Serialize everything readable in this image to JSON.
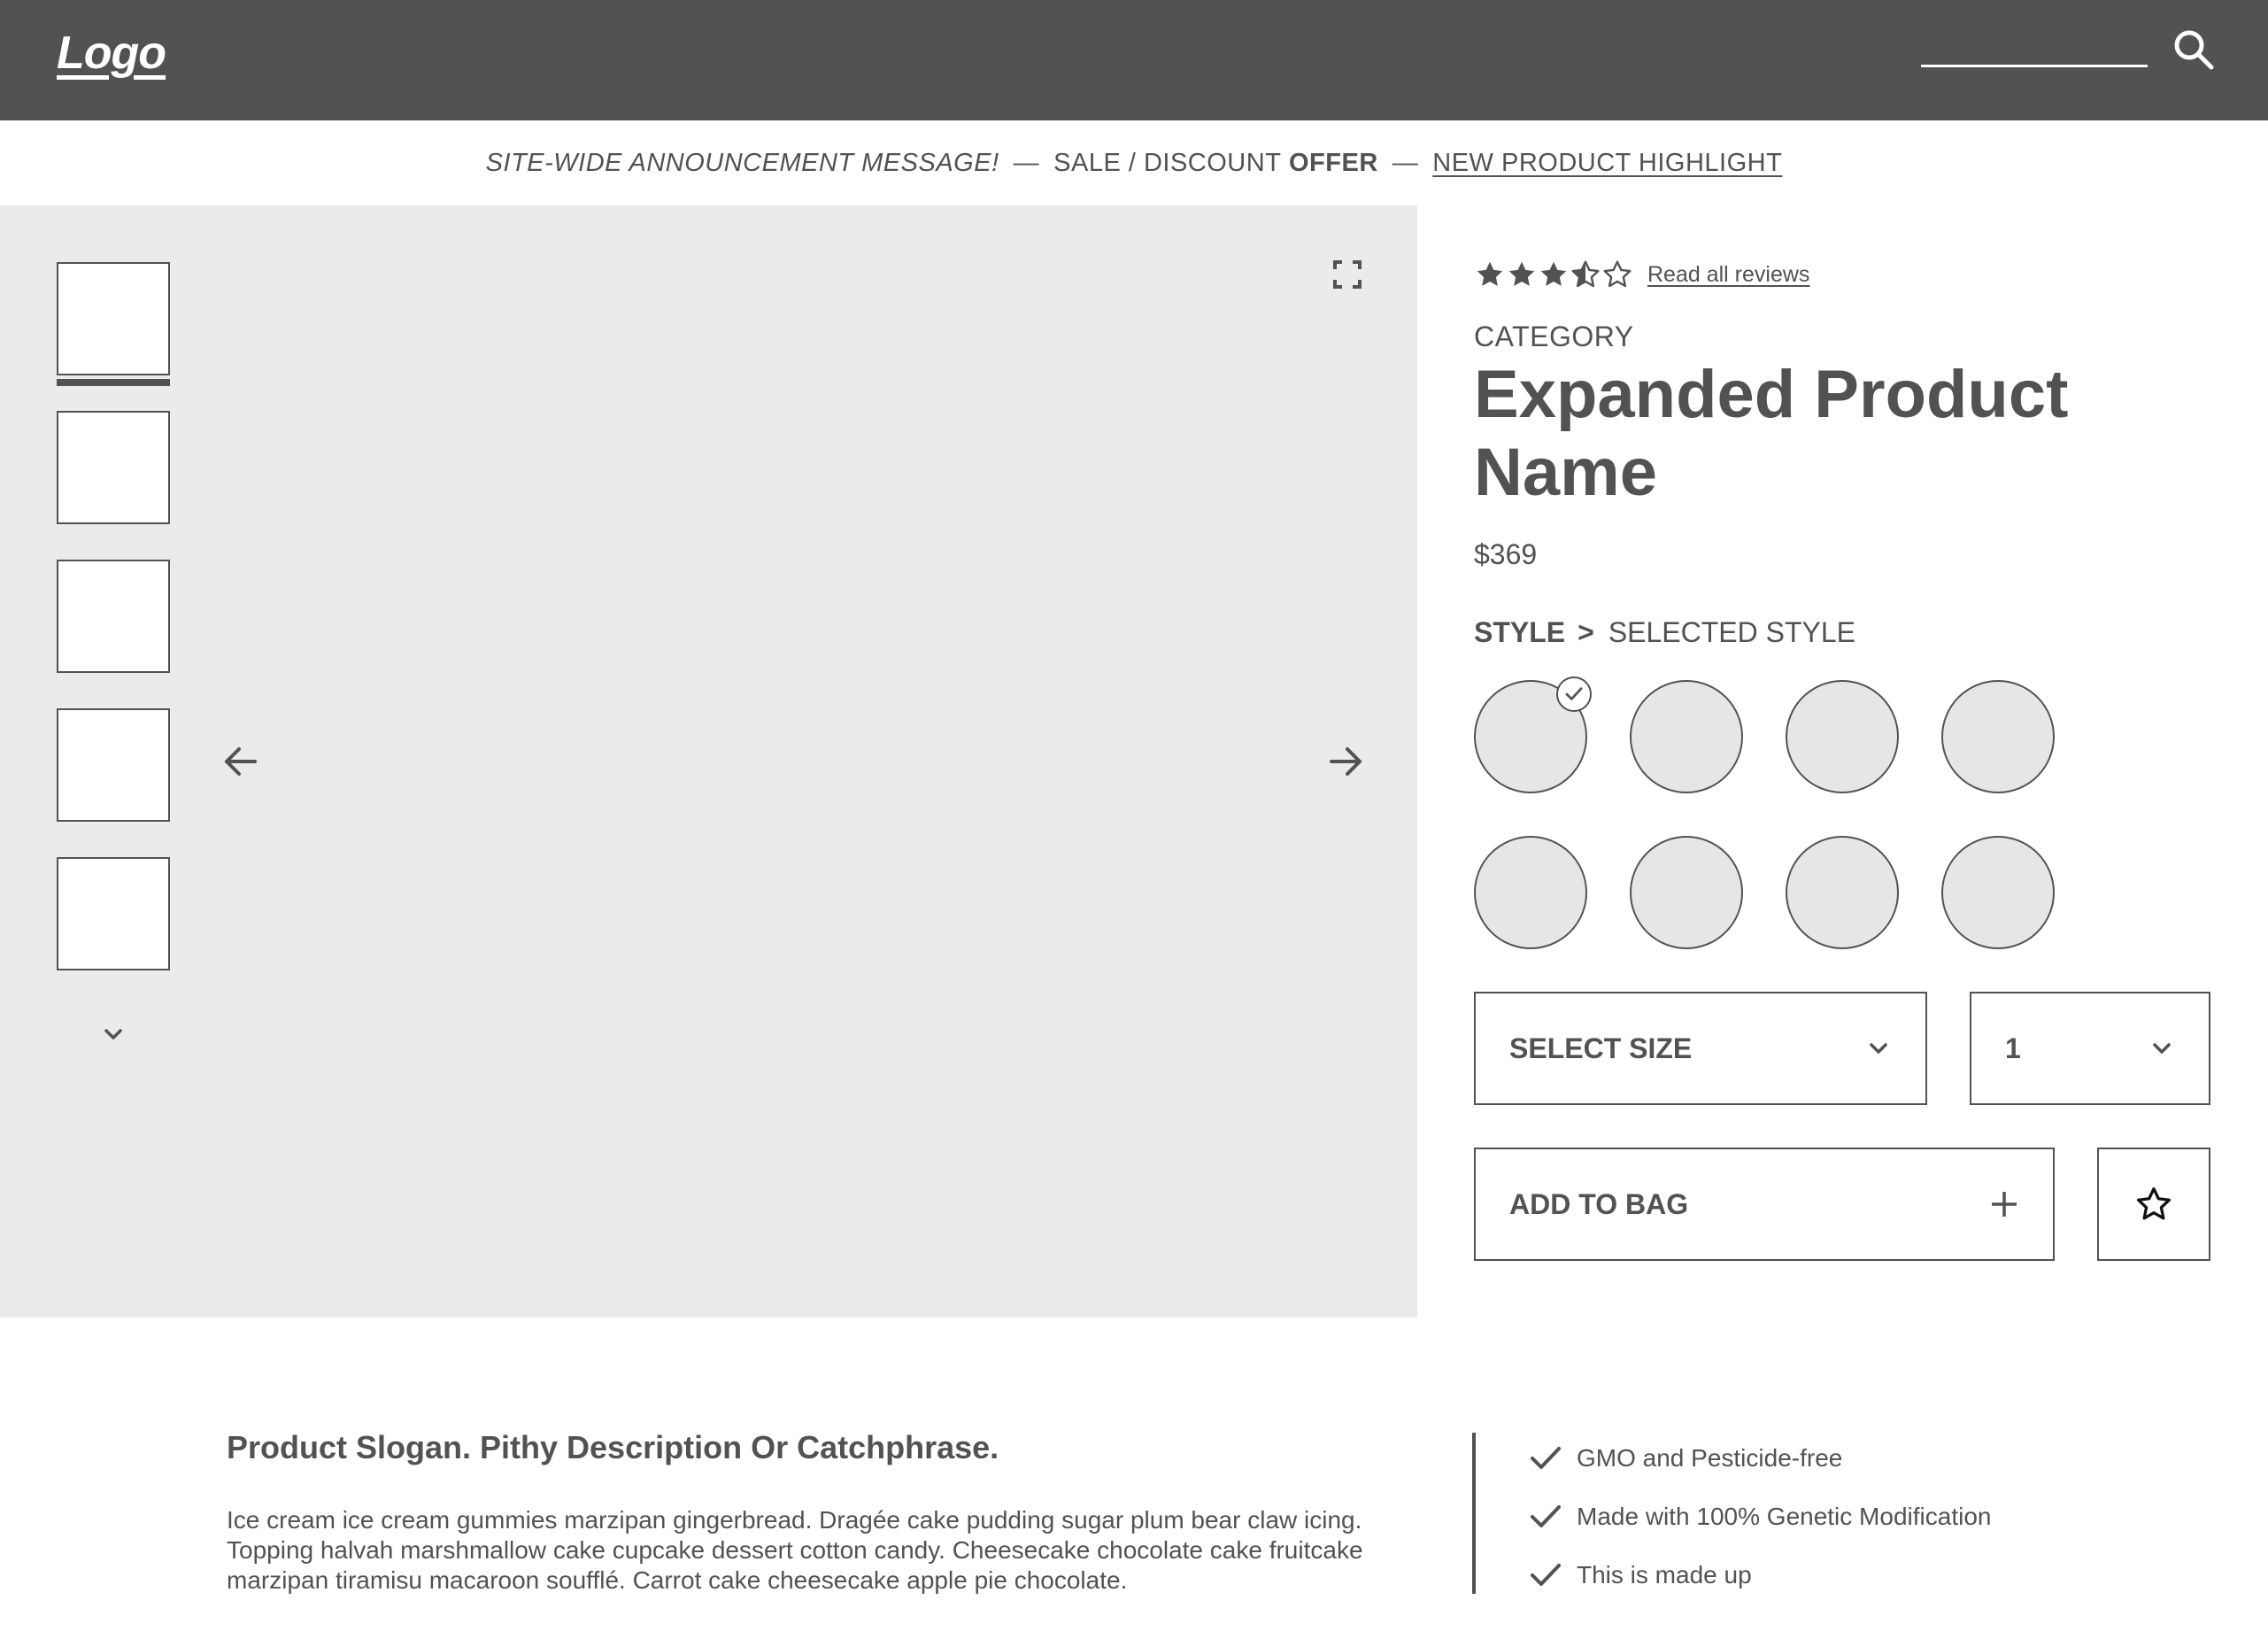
{
  "header": {
    "logo": "Logo",
    "search_icon": "search-icon"
  },
  "announcement": {
    "message": "SITE-WIDE ANNOUNCEMENT MESSAGE!",
    "sep1": "—",
    "sale": "SALE / DISCOUNT",
    "offer": "OFFER",
    "sep2": "—",
    "highlight": "NEW PRODUCT HIGHLIGHT"
  },
  "gallery": {
    "thumbnail_count": 5,
    "active_thumbnail": 1,
    "icons": {
      "expand": "fullscreen-icon",
      "prev": "arrow-left-icon",
      "next": "arrow-right-icon",
      "more": "chevron-down-icon"
    }
  },
  "product": {
    "rating": 3.5,
    "rating_max": 5,
    "reviews_link": "Read all reviews",
    "category": "CATEGORY",
    "name": "Expanded Product Name",
    "price": "$369",
    "style_label": "STYLE",
    "style_chevron": ">",
    "selected_style": "SELECTED STYLE",
    "style_swatches": 8,
    "selected_swatch": 1,
    "size_select": "SELECT SIZE",
    "quantity": "1",
    "add_to_bag": "ADD TO BAG",
    "favorite_icon": "star-icon"
  },
  "description": {
    "slogan": "Product Slogan. Pithy Description Or Catchphrase.",
    "body": "Ice cream ice cream gummies marzipan gingerbread. Dragée cake pudding sugar plum bear claw icing. Topping halvah marshmallow cake cupcake dessert cotton candy. Cheesecake chocolate cake fruitcake marzipan tiramisu macaroon soufflé. Carrot cake cheesecake apple pie chocolate.",
    "features": [
      "GMO and Pesticide-free",
      "Made with 100% Genetic Modification",
      "This is made up"
    ]
  },
  "colors": {
    "dark": "#525252",
    "gallery_bg": "#ebebeb",
    "swatch_bg": "#e6e6e6"
  }
}
